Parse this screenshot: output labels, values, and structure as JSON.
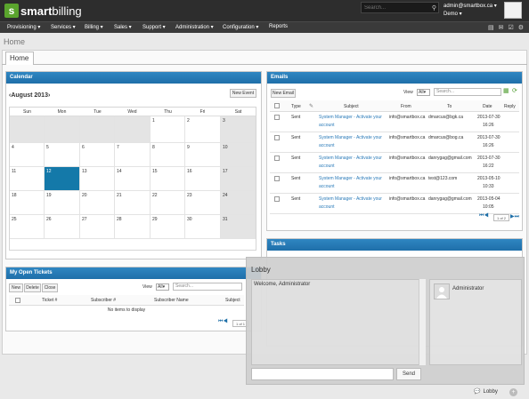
{
  "brand": {
    "logo_letter": "s",
    "name_bold": "smart",
    "name_rest": "billing",
    "color": "#5aa42d"
  },
  "header": {
    "search_placeholder": "Search...",
    "user_email": "admin@smartbox.ca ▾",
    "company": "Demo ▾"
  },
  "nav": [
    "Provisioning ▾",
    "Services ▾",
    "Billing ▾",
    "Sales ▾",
    "Support ▾",
    "Administration ▾",
    "Configuration ▾",
    "Reports"
  ],
  "breadcrumb": "Home",
  "tab": "Home",
  "calendar": {
    "title": "Calendar",
    "month": "August 2013",
    "prev": "‹",
    "next": "›",
    "new_event": "New Event",
    "dow": [
      "Sun",
      "Mon",
      "Tue",
      "Wed",
      "Thu",
      "Fri",
      "Sat"
    ],
    "weeks": [
      [
        "",
        "",
        "",
        "",
        "1",
        "2",
        "3"
      ],
      [
        "4",
        "5",
        "6",
        "7",
        "8",
        "9",
        "10"
      ],
      [
        "11",
        "12",
        "13",
        "14",
        "15",
        "16",
        "17"
      ],
      [
        "18",
        "19",
        "20",
        "21",
        "22",
        "23",
        "24"
      ],
      [
        "25",
        "26",
        "27",
        "28",
        "29",
        "30",
        "31"
      ]
    ]
  },
  "emails": {
    "title": "Emails",
    "new_email": "New Email",
    "view_label": "View",
    "view_value": "All",
    "search_placeholder": "Search...",
    "columns": [
      "Type",
      "Subject",
      "From",
      "To",
      "Date",
      "Reply"
    ],
    "rows": [
      {
        "type": "Sent",
        "subject_1": "System Manager - Activate your",
        "subject_2": "account",
        "from": "info@smartbox.ca",
        "to": "dmarcus@bgk.ca",
        "date_1": "2013-07-30",
        "date_2": "16:26"
      },
      {
        "type": "Sent",
        "subject_1": "System Manager - Activate your",
        "subject_2": "account",
        "from": "info@smartbox.ca",
        "to": "dmarcus@bog.ca",
        "date_1": "2013-07-30",
        "date_2": "16:26"
      },
      {
        "type": "Sent",
        "subject_1": "System Manager - Activate your",
        "subject_2": "account",
        "from": "info@smartbox.ca",
        "to": "danrygag@gmail.com",
        "date_1": "2013-07-30",
        "date_2": "16:22"
      },
      {
        "type": "Sent",
        "subject_1": "System Manager - Activate your",
        "subject_2": "account",
        "from": "info@smartbox.ca",
        "to": "test@123.com",
        "date_1": "2013-05-10",
        "date_2": "10:33"
      },
      {
        "type": "Sent",
        "subject_1": "System Manager - Activate your",
        "subject_2": "account",
        "from": "info@smartbox.ca",
        "to": "danrygag@gmail.com",
        "date_1": "2013-05-04",
        "date_2": "10:05"
      }
    ],
    "page": "1 of 2"
  },
  "tasks": {
    "title": "Tasks"
  },
  "tickets": {
    "title": "My Open Tickets",
    "new": "New",
    "delete": "Delete",
    "close": "Close",
    "view_label": "View",
    "view_value": "All",
    "search_placeholder": "Search...",
    "columns": [
      "Ticket #",
      "Subscriber #",
      "Subscriber Name",
      "Subject"
    ],
    "empty": "No items to display",
    "page": "1 of 1"
  },
  "lobby": {
    "title": "Lobby",
    "welcome": "Welcome, Administrator",
    "user": "Administrator",
    "send": "Send",
    "footer_label": "Lobby"
  },
  "colors": {
    "header_bg": "#2d2d2d",
    "panel_head": "#1f6fa9",
    "today": "#1479a9",
    "link": "#2b7bb9"
  }
}
